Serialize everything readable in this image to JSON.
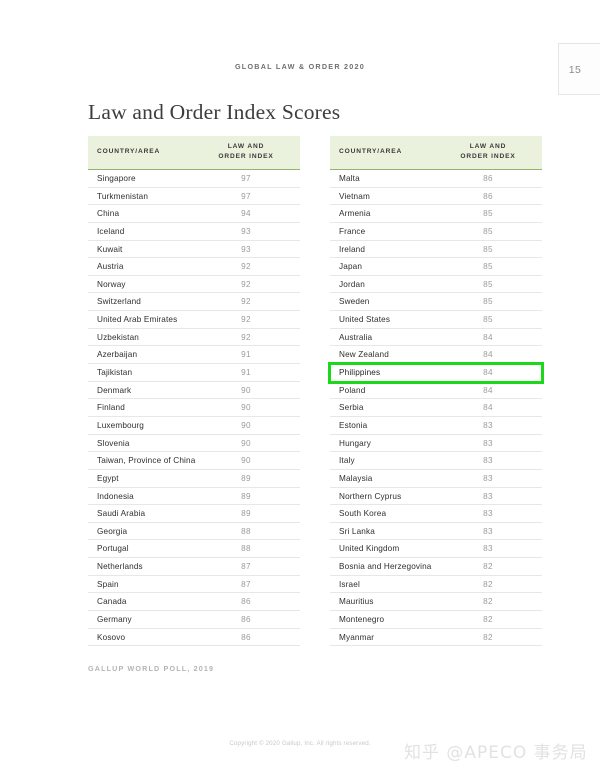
{
  "document": {
    "running_head": "GLOBAL LAW & ORDER 2020",
    "page_number": "15",
    "title": "Law and Order Index Scores",
    "source_note": "GALLUP WORLD POLL, 2019",
    "copyright": "Copyright © 2020 Gallup, Inc. All rights reserved.",
    "watermark": "知乎 @APECO 事务局"
  },
  "colors": {
    "header_bg": "#eaf1dd",
    "header_rule": "#92b56a",
    "highlight": "#1bd81b",
    "row_rule": "#e7e7e7",
    "score_text": "#9b9b9b"
  },
  "table_headers": {
    "country": "COUNTRY/AREA",
    "index_line1": "LAW AND",
    "index_line2": "ORDER INDEX"
  },
  "chart_data": {
    "type": "table",
    "title": "Law and Order Index Scores",
    "columns": [
      "COUNTRY/AREA",
      "LAW AND ORDER INDEX"
    ],
    "source": "GALLUP WORLD POLL, 2019",
    "highlighted": "Philippines",
    "left_column": [
      {
        "country": "Singapore",
        "score": "97"
      },
      {
        "country": "Turkmenistan",
        "score": "97"
      },
      {
        "country": "China",
        "score": "94"
      },
      {
        "country": "Iceland",
        "score": "93"
      },
      {
        "country": "Kuwait",
        "score": "93"
      },
      {
        "country": "Austria",
        "score": "92"
      },
      {
        "country": "Norway",
        "score": "92"
      },
      {
        "country": "Switzerland",
        "score": "92"
      },
      {
        "country": "United Arab Emirates",
        "score": "92"
      },
      {
        "country": "Uzbekistan",
        "score": "92"
      },
      {
        "country": "Azerbaijan",
        "score": "91"
      },
      {
        "country": "Tajikistan",
        "score": "91"
      },
      {
        "country": "Denmark",
        "score": "90"
      },
      {
        "country": "Finland",
        "score": "90"
      },
      {
        "country": "Luxembourg",
        "score": "90"
      },
      {
        "country": "Slovenia",
        "score": "90"
      },
      {
        "country": "Taiwan, Province of China",
        "score": "90"
      },
      {
        "country": "Egypt",
        "score": "89"
      },
      {
        "country": "Indonesia",
        "score": "89"
      },
      {
        "country": "Saudi Arabia",
        "score": "89"
      },
      {
        "country": "Georgia",
        "score": "88"
      },
      {
        "country": "Portugal",
        "score": "88"
      },
      {
        "country": "Netherlands",
        "score": "87"
      },
      {
        "country": "Spain",
        "score": "87"
      },
      {
        "country": "Canada",
        "score": "86"
      },
      {
        "country": "Germany",
        "score": "86"
      },
      {
        "country": "Kosovo",
        "score": "86"
      }
    ],
    "right_column": [
      {
        "country": "Malta",
        "score": "86"
      },
      {
        "country": "Vietnam",
        "score": "86"
      },
      {
        "country": "Armenia",
        "score": "85"
      },
      {
        "country": "France",
        "score": "85"
      },
      {
        "country": "Ireland",
        "score": "85"
      },
      {
        "country": "Japan",
        "score": "85"
      },
      {
        "country": "Jordan",
        "score": "85"
      },
      {
        "country": "Sweden",
        "score": "85"
      },
      {
        "country": "United States",
        "score": "85"
      },
      {
        "country": "Australia",
        "score": "84"
      },
      {
        "country": "New Zealand",
        "score": "84"
      },
      {
        "country": "Philippines",
        "score": "84",
        "highlighted": true
      },
      {
        "country": "Poland",
        "score": "84"
      },
      {
        "country": "Serbia",
        "score": "84"
      },
      {
        "country": "Estonia",
        "score": "83"
      },
      {
        "country": "Hungary",
        "score": "83"
      },
      {
        "country": "Italy",
        "score": "83"
      },
      {
        "country": "Malaysia",
        "score": "83"
      },
      {
        "country": "Northern Cyprus",
        "score": "83"
      },
      {
        "country": "South Korea",
        "score": "83"
      },
      {
        "country": "Sri Lanka",
        "score": "83"
      },
      {
        "country": "United Kingdom",
        "score": "83"
      },
      {
        "country": "Bosnia and Herzegovina",
        "score": "82"
      },
      {
        "country": "Israel",
        "score": "82"
      },
      {
        "country": "Mauritius",
        "score": "82"
      },
      {
        "country": "Montenegro",
        "score": "82"
      },
      {
        "country": "Myanmar",
        "score": "82"
      }
    ]
  }
}
